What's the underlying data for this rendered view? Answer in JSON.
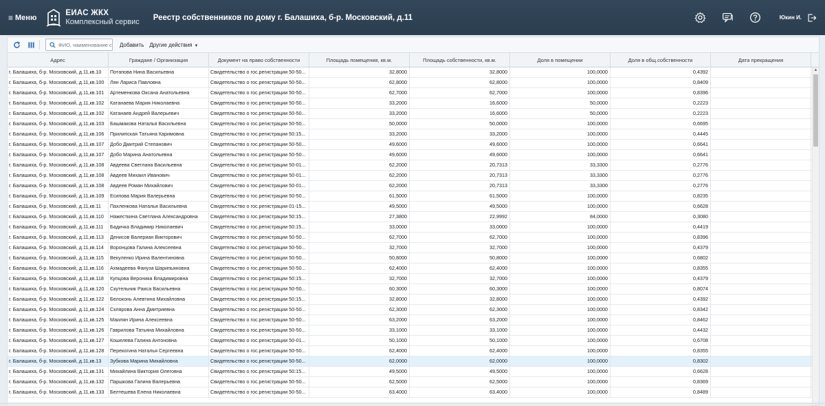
{
  "header": {
    "menu_label": "Меню",
    "logo_title": "ЕИАС ЖКХ",
    "logo_subtitle": "Комплексный сервис",
    "page_title": "Реестр собственников по дому г. Балашиха, б-р. Московский, д.11",
    "user_name": "Юкин И.",
    "icons": [
      "settings-gear-icon",
      "chat-icon",
      "help-icon",
      "logout-icon"
    ]
  },
  "toolbar": {
    "search_placeholder": "ФИО, наименование с",
    "add_label": "Добавить",
    "other_actions_label": "Другие действия",
    "icons": [
      "refresh-icon",
      "columns-icon",
      "search-icon",
      "caret-down-icon"
    ]
  },
  "grid": {
    "columns": [
      "Адрес",
      "Граждане / Организация",
      "Документ на право собственности",
      "Площадь помещения, кв.м.",
      "Площадь собственности, кв.м.",
      "Доля в помещении",
      "Доля в общ.собственности",
      "Дата прекращения"
    ],
    "rows": [
      [
        "г. Балашиха, б-р. Московский, д.11,кв.10",
        "Потапова Нина Васильевна",
        "Свидетельство о гос.регистрации 50-50...",
        "32,8000",
        "32,8000",
        "100,0000",
        "0,4392",
        ""
      ],
      [
        "г. Балашиха, б-р. Московский, д.11,кв.100",
        "Лян Лариса Павловна",
        "Свидетельство о гос.регистрации 50-50...",
        "62,8000",
        "62,8000",
        "100,0000",
        "0,8409",
        ""
      ],
      [
        "г. Балашиха, б-р. Московский, д.11,кв.101",
        "Артеменкова Оксана Анатольевна",
        "Свидетельство о гос.регистрации 50-50...",
        "62,7000",
        "62,7000",
        "100,0000",
        "0,8396",
        ""
      ],
      [
        "г. Балашиха, б-р. Московский, д.11,кв.102",
        "Катанаева Мария Николаевна",
        "Свидетельство о гос.регистрации 50-50...",
        "33,2000",
        "16,6000",
        "50,0000",
        "0,2223",
        ""
      ],
      [
        "г. Балашиха, б-р. Московский, д.11,кв.102",
        "Катанаев Андрей Валерьевич",
        "Свидетельство о гос.регистрации 50-50...",
        "33,2000",
        "16,6000",
        "50,0000",
        "0,2223",
        ""
      ],
      [
        "г. Балашиха, б-р. Московский, д.11,кв.103",
        "Башмакова Наталья Васильевна",
        "Свидетельство о гос.регистрации 50-50...",
        "50,0000",
        "50,0000",
        "100,0000",
        "0,6695",
        ""
      ],
      [
        "г. Балашиха, б-р. Московский, д.11,кв.106",
        "Прилипская Татьяна Каримовна",
        "Свидетельство о гос.регистрации 50:15...",
        "33,2000",
        "33,2000",
        "100,0000",
        "0,4445",
        ""
      ],
      [
        "г. Балашиха, б-р. Московский, д.11,кв.107",
        "Добо Дмитрий Степанович",
        "Свидетельство о гос.регистрации 50-50...",
        "49,6000",
        "49,6000",
        "100,0000",
        "0,6641",
        ""
      ],
      [
        "г. Балашиха, б-р. Московский, д.11,кв.107",
        "Добо Марина Анатольевна",
        "Свидетельство о гос.регистрации 50-50...",
        "49,6000",
        "49,6000",
        "100,0000",
        "0,6641",
        ""
      ],
      [
        "г. Балашиха, б-р. Московский, д.11,кв.108",
        "Авдеева Светлана Васильевна",
        "Свидетельство о гос.регистрации 50-01...",
        "62,2000",
        "20,7313",
        "33,3300",
        "0,2776",
        ""
      ],
      [
        "г. Балашиха, б-р. Московский, д.11,кв.108",
        "Авдеев Михаил Иванович",
        "Свидетельство о гос.регистрации 50-01...",
        "62,2000",
        "20,7313",
        "33,3300",
        "0,2776",
        ""
      ],
      [
        "г. Балашиха, б-р. Московский, д.11,кв.108",
        "Авдеев Роман Михайлович",
        "Свидетельство о гос.регистрации 50-01...",
        "62,2000",
        "20,7313",
        "33,3300",
        "0,2776",
        ""
      ],
      [
        "г. Балашиха, б-р. Московский, д.11,кв.109",
        "Есипова Мария Валерьевна",
        "Свидетельство о гос.регистрации 50-50...",
        "61,5000",
        "61,5000",
        "100,0000",
        "0,8235",
        ""
      ],
      [
        "г. Балашиха, б-р. Московский, д.11,кв.11",
        "Пахленкова Наталья Васильевна",
        "Свидетельство о гос.регистрации 01-15...",
        "49,5000",
        "49,5000",
        "100,0000",
        "0,6628",
        ""
      ],
      [
        "г. Балашиха, б-р. Московский, д.11,кв.110",
        "Нажесткина Светлана Александровна",
        "Свидетельство о гос.регистрации 50:15...",
        "27,3800",
        "22,9992",
        "84,0000",
        "0,3080",
        ""
      ],
      [
        "г. Балашиха, б-р. Московский, д.11,кв.111",
        "Бадичка Владимир Николаевич",
        "Свидетельство о гос.регистрации 50:15...",
        "33,0000",
        "33,0000",
        "100,0000",
        "0,4419",
        ""
      ],
      [
        "г. Балашиха, б-р. Московский, д.11,кв.113",
        "Денисов Валериан Викторович",
        "Свидетельство о гос.регистрации 50-50...",
        "62,7000",
        "62,7000",
        "100,0000",
        "0,8396",
        ""
      ],
      [
        "г. Балашиха, б-р. Московский, д.11,кв.114",
        "Воронцова Галина Алексеевна",
        "Свидетельство о гос.регистрации 50-50...",
        "32,7000",
        "32,7000",
        "100,0000",
        "0,4379",
        ""
      ],
      [
        "г. Балашиха, б-р. Московский, д.11,кв.115",
        "Векуленко Ирина Валентиновна",
        "Свидетельство о гос.регистрации 50-50...",
        "50,8000",
        "50,8000",
        "100,0000",
        "0,6802",
        ""
      ],
      [
        "г. Балашиха, б-р. Московский, д.11,кв.116",
        "Ахмадеева Фануза Шарипьяновна",
        "Свидетельство о гос.регистрации 50-50...",
        "62,4000",
        "62,4000",
        "100,0000",
        "0,8355",
        ""
      ],
      [
        "г. Балашиха, б-р. Московский, д.11,кв.118",
        "Купцова Вероника Владимировна",
        "Свидетельство о гос.регистрации 50:15...",
        "32,7000",
        "32,7000",
        "100,0000",
        "0,4379",
        ""
      ],
      [
        "г. Балашиха, б-р. Московский, д.11,кв.120",
        "Скутельник Раиса Васильевна",
        "Свидетельство о гос.регистрации 50-50...",
        "60,3000",
        "60,3000",
        "100,0000",
        "0,8074",
        ""
      ],
      [
        "г. Балашиха, б-р. Московский, д.11,кв.122",
        "Белоконь Алевтина Михайловна",
        "Свидетельство о гос.регистрации 50:15...",
        "32,8000",
        "32,8000",
        "100,0000",
        "0,4392",
        ""
      ],
      [
        "г. Балашиха, б-р. Московский, д.11,кв.124",
        "Склярова Анна Дмитриевна",
        "Свидетельство о гос.регистрации 50-50...",
        "62,3000",
        "62,3000",
        "100,0000",
        "0,8342",
        ""
      ],
      [
        "г. Балашиха, б-р. Московский, д.11,кв.125",
        "Маилян Ирина Алексеевна",
        "Свидетельство о гос.регистрации 50-50...",
        "63,2000",
        "63,2000",
        "100,0000",
        "0,8462",
        ""
      ],
      [
        "г. Балашиха, б-р. Московский, д.11,кв.126",
        "Гаврилова Татьяна Михайловна",
        "Свидетельство о гос.регистрации 50-50...",
        "33,1000",
        "33,1000",
        "100,0000",
        "0,4432",
        ""
      ],
      [
        "г. Балашиха, б-р. Московский, д.11,кв.127",
        "Кошелева Галина Антоновна",
        "Свидетельство о гос.регистрации 50-01...",
        "50,1000",
        "50,1000",
        "100,0000",
        "0,6708",
        ""
      ],
      [
        "г. Балашиха, б-р. Московский, д.11,кв.128",
        "Перекогина Наталья Сергеевна",
        "Свидетельство о гос.регистрации 50-50...",
        "62,4000",
        "62,4000",
        "100,0000",
        "0,8355",
        ""
      ],
      [
        "г. Балашиха, б-р. Московский, д.11,кв.13",
        "Зубкова Марина Михайловна",
        "Свидетельство о гос.регистрации 50-50...",
        "62,0000",
        "62,0000",
        "100,0000",
        "0,8302",
        ""
      ],
      [
        "г. Балашиха, б-р. Московский, д.11,кв.131",
        "Михайлина Виктория Олеговна",
        "Свидетельство о гос.регистрации 50:15...",
        "49,5000",
        "49,5000",
        "100,0000",
        "0,6628",
        ""
      ],
      [
        "г. Балашиха, б-р. Московский, д.11,кв.132",
        "Паршкова Галина Валерьевна",
        "Свидетельство о гос.регистрации 50-50...",
        "62,5000",
        "62,5000",
        "100,0000",
        "0,8369",
        ""
      ],
      [
        "г. Балашиха, б-р. Московский, д.11,кв.133",
        "Белтешева Елена Николаевна",
        "Свидетельство о гос.регистрации 50-50...",
        "63,4000",
        "63,4000",
        "100,0000",
        "0,8489",
        ""
      ]
    ],
    "selected_row_index": 28
  },
  "colors": {
    "header_bg": "#2e4154",
    "selected_row": "#e3f1fb",
    "accent": "#2a6fb0"
  }
}
